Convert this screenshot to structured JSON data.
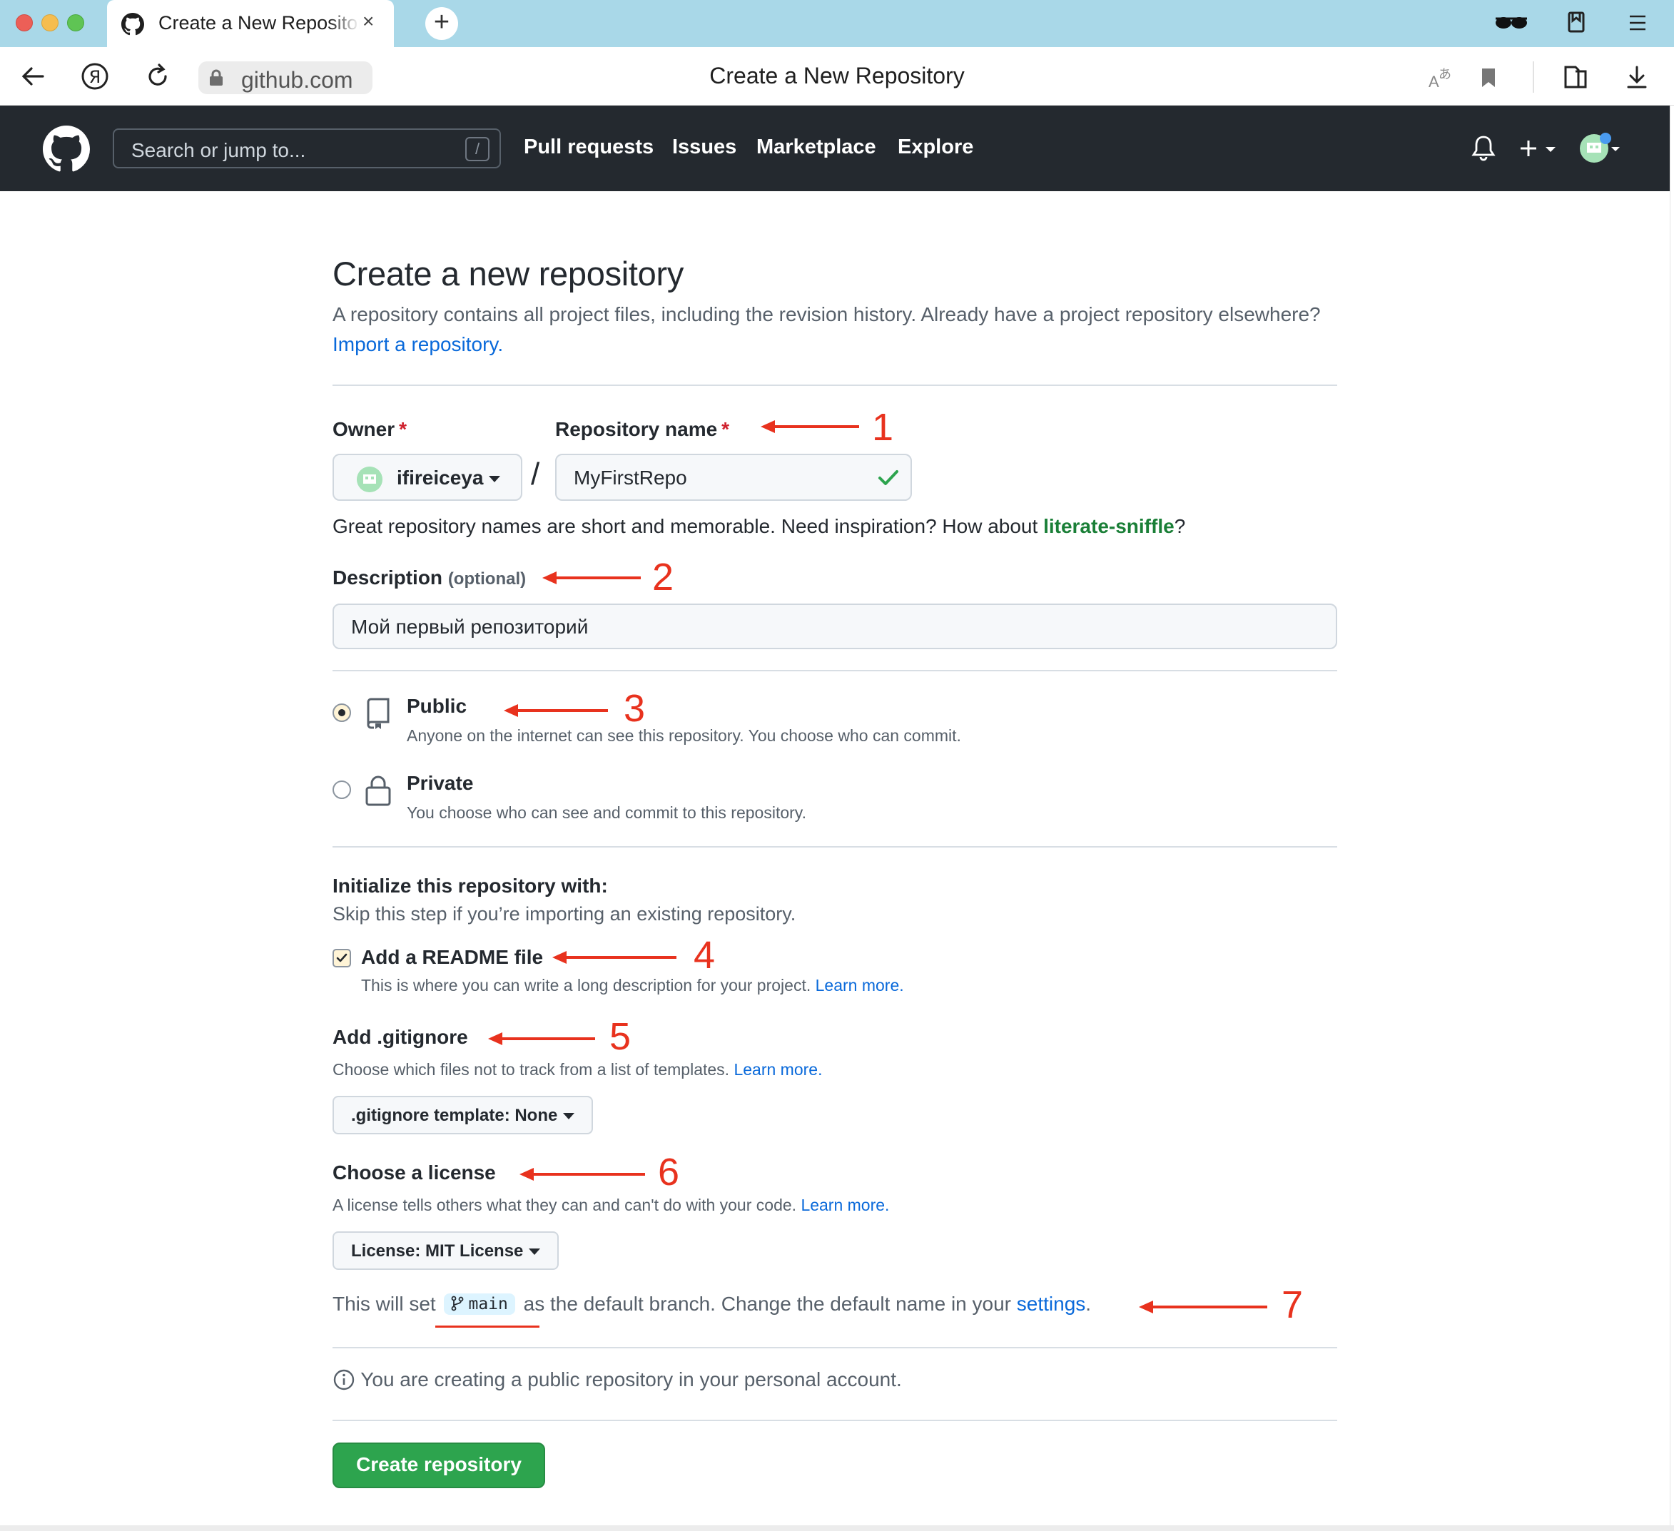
{
  "browser": {
    "tab_title": "Create a New Repository",
    "tab_close": "×",
    "new_tab": "+",
    "url": "github.com",
    "page_title": "Create a New Repository"
  },
  "github_header": {
    "search_placeholder": "Search or jump to...",
    "search_shortcut": "/",
    "nav": [
      "Pull requests",
      "Issues",
      "Marketplace",
      "Explore"
    ]
  },
  "page": {
    "heading": "Create a new repository",
    "lead_text": "A repository contains all project files, including the revision history. Already have a project repository elsewhere?",
    "import_link": "Import a repository.",
    "owner_label": "Owner",
    "repo_name_label": "Repository name",
    "required_mark": "*",
    "owner_value": "ifireiceya",
    "separator": "/",
    "repo_name_value": "MyFirstRepo",
    "name_hint_prefix": "Great repository names are short and memorable. Need inspiration? How about",
    "name_suggestion": "literate-sniffle",
    "name_hint_suffix": "?",
    "description_label": "Description",
    "description_optional": "(optional)",
    "description_value": "Мой первый репозиторий",
    "visibility": {
      "public_title": "Public",
      "public_desc": "Anyone on the internet can see this repository. You choose who can commit.",
      "private_title": "Private",
      "private_desc": "You choose who can see and commit to this repository.",
      "selected": "public"
    },
    "init_title": "Initialize this repository with:",
    "init_sub": "Skip this step if you’re importing an existing repository.",
    "readme_label": "Add a README file",
    "readme_checked": true,
    "readme_desc": "This is where you can write a long description for your project.",
    "learn_more": "Learn more.",
    "gitignore_title": "Add .gitignore",
    "gitignore_desc": "Choose which files not to track from a list of templates.",
    "gitignore_select": ".gitignore template: None",
    "license_title": "Choose a license",
    "license_desc": "A license tells others what they can and can't do with your code.",
    "license_select": "License: MIT License",
    "branch_prefix": "This will set",
    "branch_name": "main",
    "branch_middle": "as the default branch. Change the default name in your",
    "settings_link": "settings",
    "branch_suffix": ".",
    "info_text": "You are creating a public repository in your personal account.",
    "create_button": "Create repository"
  },
  "annotations": [
    "1",
    "2",
    "3",
    "4",
    "5",
    "6",
    "7"
  ],
  "colors": {
    "tabbar": "#a9d8e8",
    "gh_header": "#24292f",
    "link": "#0969da",
    "success_green": "#2da44e",
    "annotation_red": "#e8321e"
  }
}
